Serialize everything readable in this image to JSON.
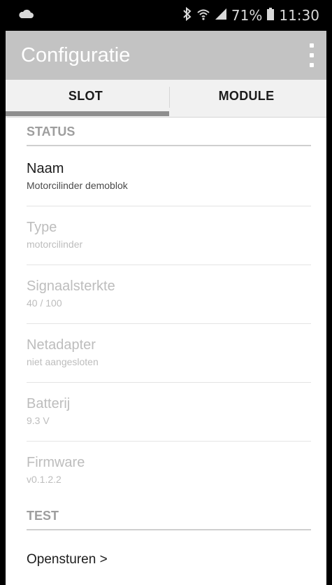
{
  "status_bar": {
    "battery_percent": "71%",
    "time": "11:30",
    "icons": [
      "cloud-icon",
      "bluetooth-icon",
      "wifi-icon",
      "signal-icon",
      "battery-icon"
    ]
  },
  "app_bar": {
    "title": "Configuratie"
  },
  "tabs": [
    {
      "label": "SLOT",
      "selected": true
    },
    {
      "label": "MODULE",
      "selected": false
    }
  ],
  "sections": {
    "status": {
      "header": "STATUS"
    },
    "test": {
      "header": "TEST"
    }
  },
  "items": [
    {
      "title": "Naam",
      "value": "Motorcilinder demoblok",
      "enabled": true
    },
    {
      "title": "Type",
      "value": "motorcilinder",
      "enabled": false
    },
    {
      "title": "Signaalsterkte",
      "value": "40 / 100",
      "enabled": false
    },
    {
      "title": "Netadapter",
      "value": "niet aangesloten",
      "enabled": false
    },
    {
      "title": "Batterij",
      "value": "9.3 V",
      "enabled": false
    },
    {
      "title": "Firmware",
      "value": "v0.1.2.2",
      "enabled": false
    }
  ],
  "test_action": {
    "label": "Opensturen >"
  }
}
